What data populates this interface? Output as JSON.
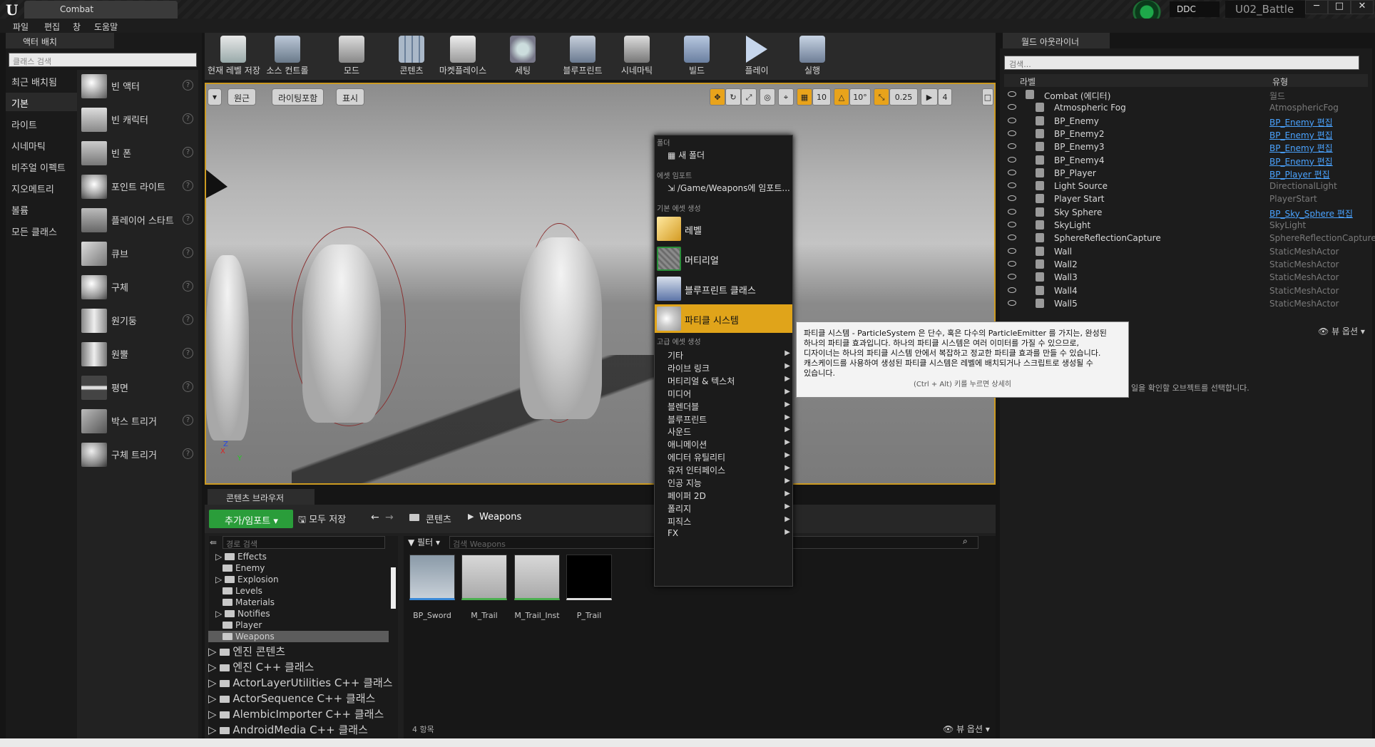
{
  "window": {
    "tab_title": "Combat",
    "ddc": "DDC",
    "project": "U02_Battle",
    "min": "─",
    "max": "□",
    "close": "✕"
  },
  "menubar": {
    "items": [
      "파일",
      "편집",
      "창",
      "도움말"
    ]
  },
  "modes": {
    "tab": "액터 배치",
    "search_placeholder": "클래스 검색",
    "categories": [
      "최근 배치됨",
      "기본",
      "라이트",
      "시네마틱",
      "비주얼 이펙트",
      "지오메트리",
      "볼륨",
      "모든 클래스"
    ],
    "items": [
      "빈 액터",
      "빈 캐릭터",
      "빈 폰",
      "포인트 라이트",
      "플레이어 스타트",
      "큐브",
      "구체",
      "원기둥",
      "원뿔",
      "평면",
      "박스 트리거",
      "구체 트리거"
    ]
  },
  "toolbar": {
    "items": [
      "현재 레벨 저장",
      "소스 컨트롤",
      "모드",
      "콘텐츠",
      "마켓플레이스",
      "세팅",
      "블루프린트",
      "시네마틱",
      "빌드",
      "플레이",
      "실행"
    ]
  },
  "viewport": {
    "perspective": "원근",
    "lighting": "라이팅포함",
    "show": "표시",
    "grid_snap": "10",
    "rot_snap": "10°",
    "scale_snap": "0.25",
    "cam_speed": "4",
    "axis_z": "Z",
    "axis_x": "X",
    "axis_y": "Y"
  },
  "context_menu": {
    "hdr_folder": "폴더",
    "new_folder": "새 폴더",
    "hdr_import": "에셋 임포트",
    "import_to": "/Game/Weapons에 임포트...",
    "hdr_basic": "기본 에셋 생성",
    "basic": [
      "레벨",
      "머티리얼",
      "블루프린트 클래스",
      "파티클 시스템"
    ],
    "hdr_advanced": "고급 에셋 생성",
    "advanced": [
      "기타",
      "라이브 링크",
      "머티리얼 & 텍스처",
      "미디어",
      "블렌더블",
      "블루프린트",
      "사운드",
      "애니메이션",
      "에디터 유틸리티",
      "유저 인터페이스",
      "인공 지능",
      "페이퍼 2D",
      "폴리지",
      "피직스",
      "FX"
    ]
  },
  "tooltip": {
    "line1": "파티클 시스템 - ParticleSystem 은 단수, 혹은 다수의 ParticleEmitter 를 가지는, 완성된",
    "line2": "하나의 파티클 효과입니다. 하나의 파티클 시스템은 여러 이미터를 가질 수 있으므로,",
    "line3": "디자이너는 하나의 파티클 시스템 안에서 복잡하고 정교한 파티클 효과를 만들 수 있습니다.",
    "line4": "캐스케이드를 사용하여 생성된 파티클 시스템은 레벨에 배치되거나 스크립트로 생성될 수",
    "line5": "있습니다.",
    "hint": "(Ctrl + Alt) 키를 누르면 상세히"
  },
  "content_browser": {
    "tab": "콘텐츠 브라우저",
    "add_import": "추가/임포트",
    "save_all": "모두 저장",
    "crumb_root": "콘텐츠",
    "crumb_current": "Weapons",
    "path_search_placeholder": "경로 검색",
    "filter": "필터",
    "asset_search_placeholder": "검색 Weapons",
    "folders": [
      "Effects",
      "Enemy",
      "Explosion",
      "Levels",
      "Materials",
      "Notifies",
      "Player",
      "Weapons"
    ],
    "root_folders": [
      "엔진 콘텐츠",
      "엔진 C++ 클래스",
      "ActorLayerUtilities C++ 클래스",
      "ActorSequence C++ 클래스",
      "AlembicImporter C++ 클래스",
      "AndroidMedia C++ 클래스"
    ],
    "assets": [
      "BP_Sword",
      "M_Trail",
      "M_Trail_Inst",
      "P_Trail"
    ],
    "item_count": "4 항목",
    "view_options": "뷰 옵션"
  },
  "world_outliner": {
    "tab": "월드 아웃라이너",
    "search_placeholder": "검색...",
    "col_label": "라벨",
    "col_type": "유형",
    "rows": [
      {
        "label": "Combat (에디터)",
        "type": "월드",
        "link": false
      },
      {
        "label": "Atmospheric Fog",
        "type": "AtmosphericFog",
        "link": false
      },
      {
        "label": "BP_Enemy",
        "type": "BP_Enemy 편집",
        "link": true
      },
      {
        "label": "BP_Enemy2",
        "type": "BP_Enemy 편집",
        "link": true
      },
      {
        "label": "BP_Enemy3",
        "type": "BP_Enemy 편집",
        "link": true
      },
      {
        "label": "BP_Enemy4",
        "type": "BP_Enemy 편집",
        "link": true
      },
      {
        "label": "BP_Player",
        "type": "BP_Player 편집",
        "link": true
      },
      {
        "label": "Light Source",
        "type": "DirectionalLight",
        "link": false
      },
      {
        "label": "Player Start",
        "type": "PlayerStart",
        "link": false
      },
      {
        "label": "Sky Sphere",
        "type": "BP_Sky_Sphere 편집",
        "link": true
      },
      {
        "label": "SkyLight",
        "type": "SkyLight",
        "link": false
      },
      {
        "label": "SphereReflectionCapture",
        "type": "SphereReflectionCapture",
        "link": false
      },
      {
        "label": "Wall",
        "type": "StaticMeshActor",
        "link": false
      },
      {
        "label": "Wall2",
        "type": "StaticMeshActor",
        "link": false
      },
      {
        "label": "Wall3",
        "type": "StaticMeshActor",
        "link": false
      },
      {
        "label": "Wall4",
        "type": "StaticMeshActor",
        "link": false
      },
      {
        "label": "Wall5",
        "type": "StaticMeshActor",
        "link": false
      }
    ],
    "view_options": "뷰 옵션",
    "details_hint": "일을 확인할 오브젝트를 선택합니다."
  }
}
